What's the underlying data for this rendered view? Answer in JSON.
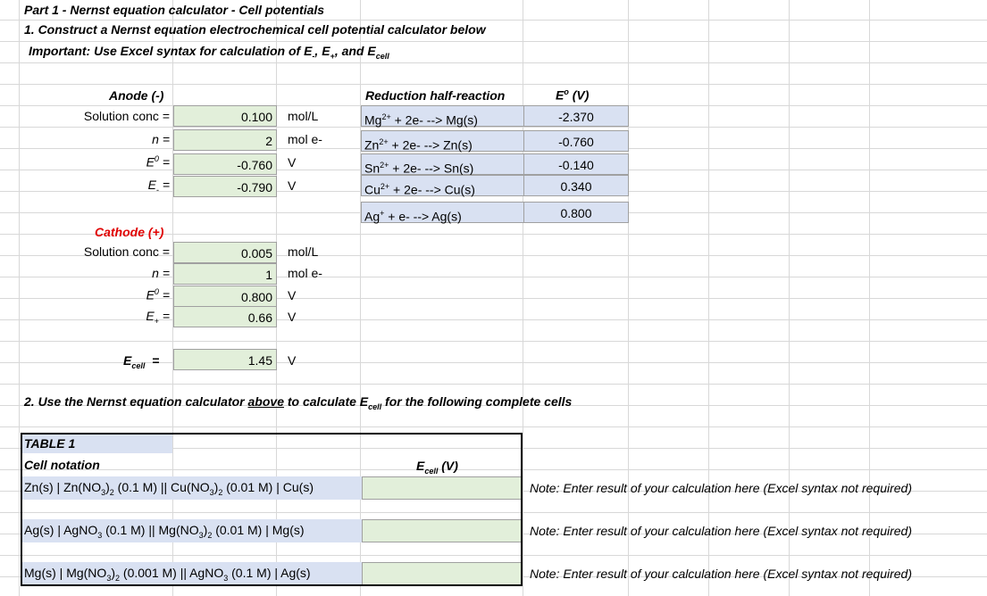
{
  "header": {
    "title": "Part 1 - Nernst equation calculator - Cell potentials",
    "step1": "1. Construct a Nernst equation electrochemical cell potential calculator below",
    "important": "Important:  Use Excel syntax for calculation of E",
    "imp_minus": "-",
    "imp_sep": ", E",
    "imp_plus": "+",
    "imp_and": ", and E",
    "imp_cell": "cell"
  },
  "anode": {
    "heading": "Anode (-)",
    "rows": [
      {
        "label": "Solution conc =",
        "value": "0.100",
        "unit": "mol/L"
      },
      {
        "label": "n =",
        "value": "2",
        "unit": "mol e-"
      },
      {
        "label": "=",
        "symbol": "E",
        "sup": "0",
        "value": "-0.760",
        "unit": "V"
      },
      {
        "label": "=",
        "symbol": "E",
        "sub": "-",
        "value": "-0.790",
        "unit": "V"
      }
    ]
  },
  "cathode": {
    "heading": "Cathode (+)",
    "rows": [
      {
        "label": "Solution conc =",
        "value": "0.005",
        "unit": "mol/L"
      },
      {
        "label": "n =",
        "value": "1",
        "unit": "mol e-"
      },
      {
        "label": "=",
        "symbol": "E",
        "sup": "0",
        "value": "0.800",
        "unit": "V"
      },
      {
        "label": "=",
        "symbol": "E",
        "sub": "+",
        "value": "0.66",
        "unit": "V"
      }
    ]
  },
  "ecell": {
    "symbol": "E",
    "sub": "cell",
    "eq": "=",
    "value": "1.45",
    "unit": "V"
  },
  "reduction_table": {
    "col1": "Reduction half-reaction",
    "col2_symbol": "E",
    "col2_sup": "o",
    "col2_unit": "(V)",
    "rows": [
      {
        "ion": "Mg",
        "charge": "2+",
        "rest": " + 2e- --> Mg(s)",
        "e0": "-2.370"
      },
      {
        "ion": "Zn",
        "charge": "2+",
        "rest": " + 2e- --> Zn(s)",
        "e0": "-0.760"
      },
      {
        "ion": "Sn",
        "charge": "2+",
        "rest": " + 2e- --> Sn(s)",
        "e0": "-0.140"
      },
      {
        "ion": "Cu",
        "charge": "2+",
        "rest": " + 2e- --> Cu(s)",
        "e0": "0.340"
      },
      {
        "ion": "Ag",
        "charge": "+",
        "rest": " + e- --> Ag(s)",
        "e0": "0.800"
      }
    ]
  },
  "part2": {
    "prefix": "2. Use the Nernst equation calculator ",
    "underlined": "above",
    "middle": " to calculate E",
    "sub": "cell",
    "suffix": " for the following complete cells"
  },
  "table1": {
    "title": "TABLE 1",
    "col1": "Cell notation",
    "col2_symbol": "E",
    "col2_sub": "cell",
    "col2_unit": "(V)",
    "note": "Note:  Enter result of your calculation here (Excel syntax not required)",
    "rows": [
      {
        "parts": [
          "Zn(s) | Zn(NO",
          "3",
          ")",
          "2",
          " (0.1 M) || Cu(NO",
          "3",
          ")",
          "2",
          " (0.01 M) | Cu(s)"
        ]
      },
      {
        "parts": [
          "Ag(s) | AgNO",
          "3",
          " (0.1 M) || Mg(NO",
          "3",
          ")",
          "2",
          " (0.01 M) | Mg(s)"
        ]
      },
      {
        "parts": [
          "Mg(s) | Mg(NO",
          "3",
          ")",
          "2",
          " (0.001 M) || AgNO",
          "3",
          " (0.1 M) | Ag(s)"
        ]
      }
    ]
  }
}
